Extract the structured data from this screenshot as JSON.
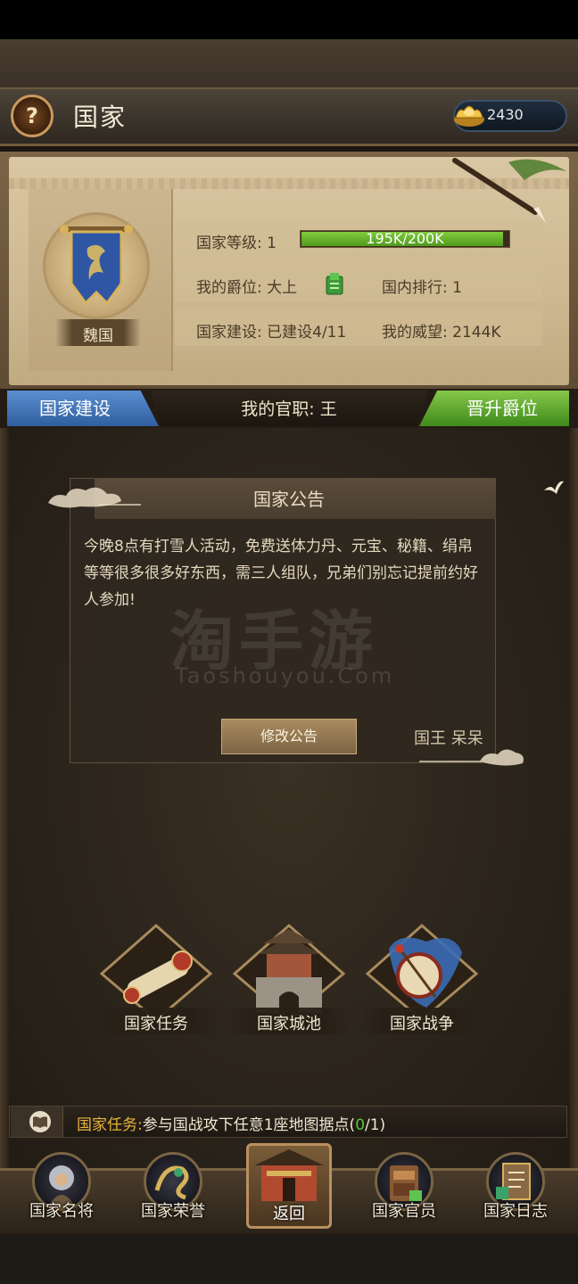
{
  "header": {
    "title": "国家",
    "help_icon": "question-mark",
    "currency": {
      "icon": "gold-ingot-icon",
      "value": "2430"
    }
  },
  "country": {
    "name": "魏国",
    "level_label": "国家等级: 1",
    "level_progress_text": "195K/200K",
    "level_progress": 0.975,
    "rank_label": "我的爵位: 大上",
    "domestic_rank_label": "国内排行: 1",
    "construction_label": "国家建设: 已建设4/11",
    "prestige_label": "我的威望: 2144K"
  },
  "ribbon": {
    "build_button": "国家建设",
    "office_text": "我的官职: 王",
    "promote_button": "晋升爵位"
  },
  "notice": {
    "title": "国家公告",
    "content": "今晚8点有打雪人活动，免费送体力丹、元宝、秘籍、绢帛等等很多很多好东西，需三人组队，兄弟们别忘记提前约好人参加!",
    "edit_button": "修改公告",
    "signature": "国王 呆呆",
    "watermark_cn": "淘手游",
    "watermark_en": "Taoshouyou.Com"
  },
  "features": [
    {
      "label": "国家任务",
      "icon": "scroll-icon"
    },
    {
      "label": "国家城池",
      "icon": "city-gate-icon"
    },
    {
      "label": "国家战争",
      "icon": "war-drum-icon"
    }
  ],
  "task": {
    "prefix": "国家任务:",
    "text": "参与国战攻下任意1座地图据点(",
    "done": "0",
    "rest": "/1)"
  },
  "bottom_nav": [
    {
      "label": "国家名将",
      "icon": "general-icon"
    },
    {
      "label": "国家荣誉",
      "icon": "dragon-honor-icon"
    },
    {
      "label": "返回",
      "icon": "palace-icon"
    },
    {
      "label": "国家官员",
      "icon": "official-cabinet-icon"
    },
    {
      "label": "国家日志",
      "icon": "log-book-icon"
    }
  ],
  "colors": {
    "accent_blue": "#2f5ea0",
    "accent_green": "#3e8a1b",
    "progress_green": "#7fcc3c",
    "task_highlight": "#e9b43a"
  }
}
